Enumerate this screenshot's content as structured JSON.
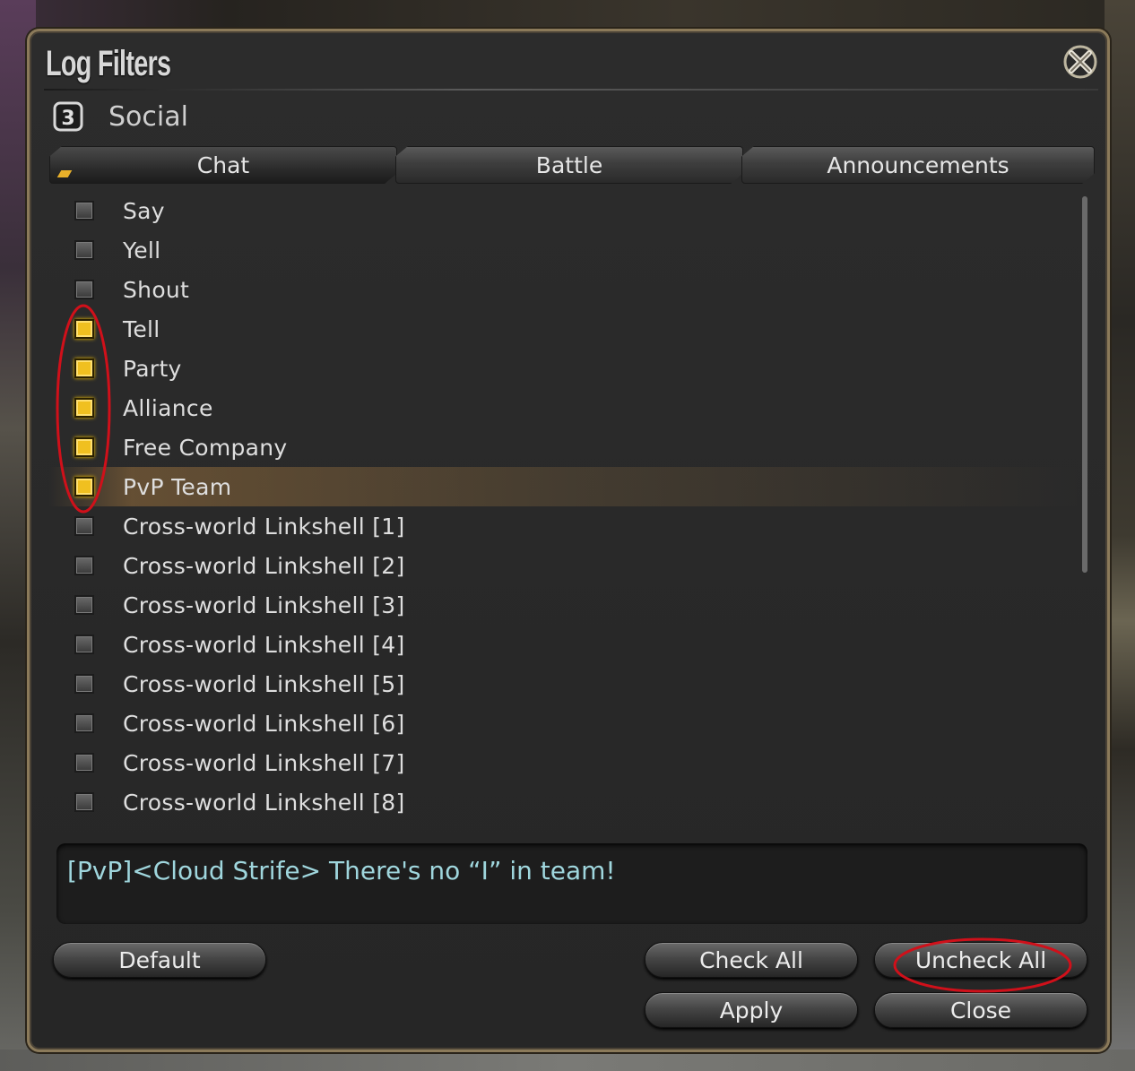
{
  "window": {
    "title": "Log Filters",
    "subtitle": "Social",
    "chat_number": "3"
  },
  "tabs": [
    {
      "label": "Chat",
      "active": true
    },
    {
      "label": "Battle",
      "active": false
    },
    {
      "label": "Announcements",
      "active": false
    }
  ],
  "filters": [
    {
      "label": "Say",
      "checked": false
    },
    {
      "label": "Yell",
      "checked": false
    },
    {
      "label": "Shout",
      "checked": false
    },
    {
      "label": "Tell",
      "checked": true
    },
    {
      "label": "Party",
      "checked": true
    },
    {
      "label": "Alliance",
      "checked": true
    },
    {
      "label": "Free Company",
      "checked": true
    },
    {
      "label": "PvP Team",
      "checked": true,
      "highlighted": true
    },
    {
      "label": "Cross-world Linkshell [1]",
      "checked": false
    },
    {
      "label": "Cross-world Linkshell [2]",
      "checked": false
    },
    {
      "label": "Cross-world Linkshell [3]",
      "checked": false
    },
    {
      "label": "Cross-world Linkshell [4]",
      "checked": false
    },
    {
      "label": "Cross-world Linkshell [5]",
      "checked": false
    },
    {
      "label": "Cross-world Linkshell [6]",
      "checked": false
    },
    {
      "label": "Cross-world Linkshell [7]",
      "checked": false
    },
    {
      "label": "Cross-world Linkshell [8]",
      "checked": false
    }
  ],
  "preview": {
    "text": "[PvP]<Cloud Strife> There's no “I” in team!"
  },
  "buttons": {
    "default": "Default",
    "check_all": "Check All",
    "uncheck_all": "Uncheck All",
    "apply": "Apply",
    "close": "Close"
  },
  "colors": {
    "checked": "#f0c020",
    "annotation": "#d0101a",
    "preview_text": "#9fd6dd"
  }
}
